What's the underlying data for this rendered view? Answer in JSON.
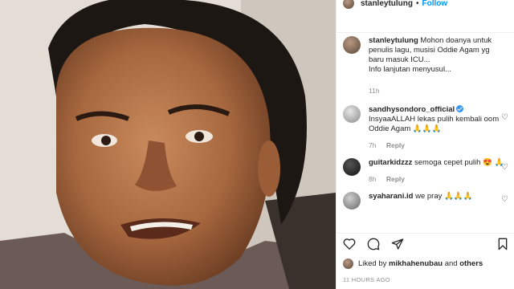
{
  "post": {
    "username": "stanleytulung",
    "dot": "•",
    "follow_label": "Follow"
  },
  "caption": {
    "username": "stanleytulung",
    "text": "Mohon doanya untuk penulis lagu, musisi Oddie Agam yg baru masuk ICU...",
    "text2": "Info lanjutan menyusul...",
    "time": "11h"
  },
  "comments": [
    {
      "username": "sandhysondoro_official",
      "verified": true,
      "text": "InsyaaALLAH lekas pulih kembali oom Oddie Agam 🙏🙏🙏",
      "time": "7h",
      "reply": "Reply"
    },
    {
      "username": "guitarkidzzz",
      "verified": false,
      "text": "semoga cepet pulih 😍 🙏",
      "time": "8h",
      "reply": "Reply"
    },
    {
      "username": "syaharani.id",
      "verified": false,
      "text": "we pray 🙏🙏🙏",
      "time": "",
      "reply": ""
    }
  ],
  "likes": {
    "prefix": "Liked by",
    "user": "mikhahenubau",
    "and": "and",
    "others": "others"
  },
  "timestamp": "11 HOURS AGO",
  "icons": [
    "heart-icon",
    "comment-icon",
    "share-icon",
    "bookmark-icon"
  ]
}
